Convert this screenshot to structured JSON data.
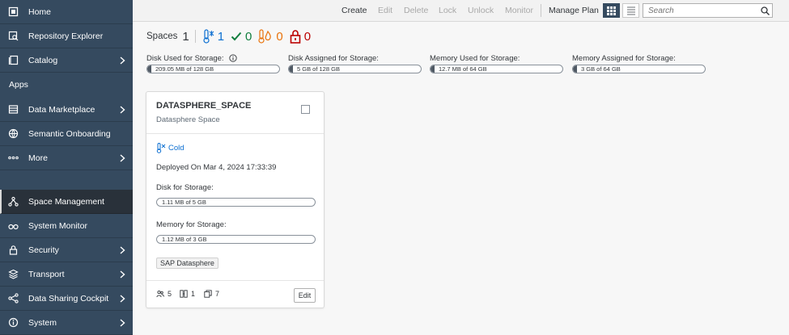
{
  "sidebar": {
    "items": [
      {
        "label": "Home",
        "icon": "home-icon",
        "chevron": false
      },
      {
        "label": "Repository Explorer",
        "icon": "repository-icon",
        "chevron": false
      },
      {
        "label": "Catalog",
        "icon": "catalog-icon",
        "chevron": true
      },
      {
        "label": "Data Marketplace",
        "icon": "marketplace-icon",
        "chevron": true
      },
      {
        "label": "Semantic Onboarding",
        "icon": "onboarding-icon",
        "chevron": false
      },
      {
        "label": "More",
        "icon": "more-icon",
        "chevron": true
      },
      {
        "label": "Space Management",
        "icon": "space-management-icon",
        "chevron": false,
        "active": true
      },
      {
        "label": "System Monitor",
        "icon": "monitor-icon",
        "chevron": false
      },
      {
        "label": "Security",
        "icon": "lock-icon",
        "chevron": true
      },
      {
        "label": "Transport",
        "icon": "transport-icon",
        "chevron": true
      },
      {
        "label": "Data Sharing Cockpit",
        "icon": "share-icon",
        "chevron": true
      },
      {
        "label": "System",
        "icon": "info-icon",
        "chevron": true
      }
    ],
    "apps_label": "Apps"
  },
  "toolbar": {
    "create": "Create",
    "edit": "Edit",
    "delete": "Delete",
    "lock": "Lock",
    "unlock": "Unlock",
    "monitor": "Monitor",
    "manage_plan": "Manage Plan",
    "search_placeholder": "Search"
  },
  "summary": {
    "title": "Spaces",
    "total": "1",
    "cold": "1",
    "ok": "0",
    "hot": "0",
    "locked": "0"
  },
  "metrics": [
    {
      "label": "Disk Used for Storage:",
      "value": "209.05 MB of 128 GB"
    },
    {
      "label": "Disk Assigned for Storage:",
      "value": "5 GB of 128 GB"
    },
    {
      "label": "Memory Used for Storage:",
      "value": "12.7 MB of 64 GB"
    },
    {
      "label": "Memory Assigned for Storage:",
      "value": "3 GB of 64 GB"
    }
  ],
  "card": {
    "title": "DATASPHERE_SPACE",
    "subtitle": "Datasphere Space",
    "status": "Cold",
    "deployed": "Deployed On Mar 4, 2024 17:33:39",
    "disk_label": "Disk for Storage:",
    "disk_value": "1.11 MB of 5 GB",
    "memory_label": "Memory for Storage:",
    "memory_value": "1.12 MB of 3 GB",
    "tag": "SAP Datasphere",
    "users": "5",
    "connections": "1",
    "objects": "7",
    "edit": "Edit"
  },
  "colors": {
    "sidebar": "#354a5f",
    "accent": "#0a6ed1",
    "success": "#107e3e",
    "warning": "#e9730c",
    "error": "#bb0000"
  }
}
